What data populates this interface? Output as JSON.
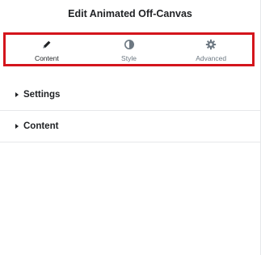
{
  "panel": {
    "title": "Edit Animated Off-Canvas"
  },
  "tabs": [
    {
      "label": "Content",
      "icon": "pencil-icon",
      "active": true
    },
    {
      "label": "Style",
      "icon": "half-circle-icon",
      "active": false
    },
    {
      "label": "Advanced",
      "icon": "gear-icon",
      "active": false
    }
  ],
  "sections": [
    {
      "label": "Settings",
      "icon": "caret-right-icon"
    },
    {
      "label": "Content",
      "icon": "caret-right-icon"
    }
  ],
  "colors": {
    "highlight_border": "#d4151c",
    "text": "#1f2124",
    "muted": "#6d7882",
    "divider": "#e6e8ea"
  }
}
